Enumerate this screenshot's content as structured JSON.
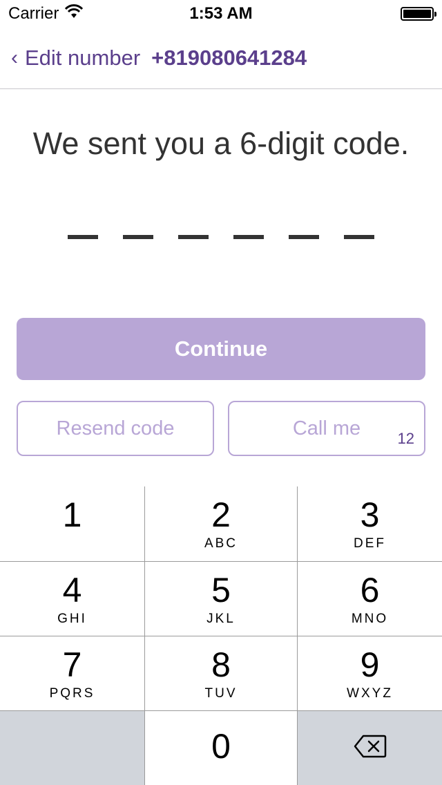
{
  "status_bar": {
    "carrier": "Carrier",
    "time": "1:53 AM"
  },
  "nav": {
    "back_label": "Edit number",
    "phone": "+819080641284"
  },
  "headline": "We sent you a 6-digit code.",
  "code_length": 6,
  "buttons": {
    "continue": "Continue",
    "resend": "Resend code",
    "call": "Call me",
    "call_counter": "12"
  },
  "keypad": {
    "keys": [
      {
        "digit": "1",
        "letters": ""
      },
      {
        "digit": "2",
        "letters": "ABC"
      },
      {
        "digit": "3",
        "letters": "DEF"
      },
      {
        "digit": "4",
        "letters": "GHI"
      },
      {
        "digit": "5",
        "letters": "JKL"
      },
      {
        "digit": "6",
        "letters": "MNO"
      },
      {
        "digit": "7",
        "letters": "PQRS"
      },
      {
        "digit": "8",
        "letters": "TUV"
      },
      {
        "digit": "9",
        "letters": "WXYZ"
      },
      {
        "digit": "0",
        "letters": ""
      }
    ]
  },
  "colors": {
    "accent": "#5b3f8c",
    "button_disabled": "#b8a6d6",
    "keypad_gray": "#d1d5db"
  }
}
